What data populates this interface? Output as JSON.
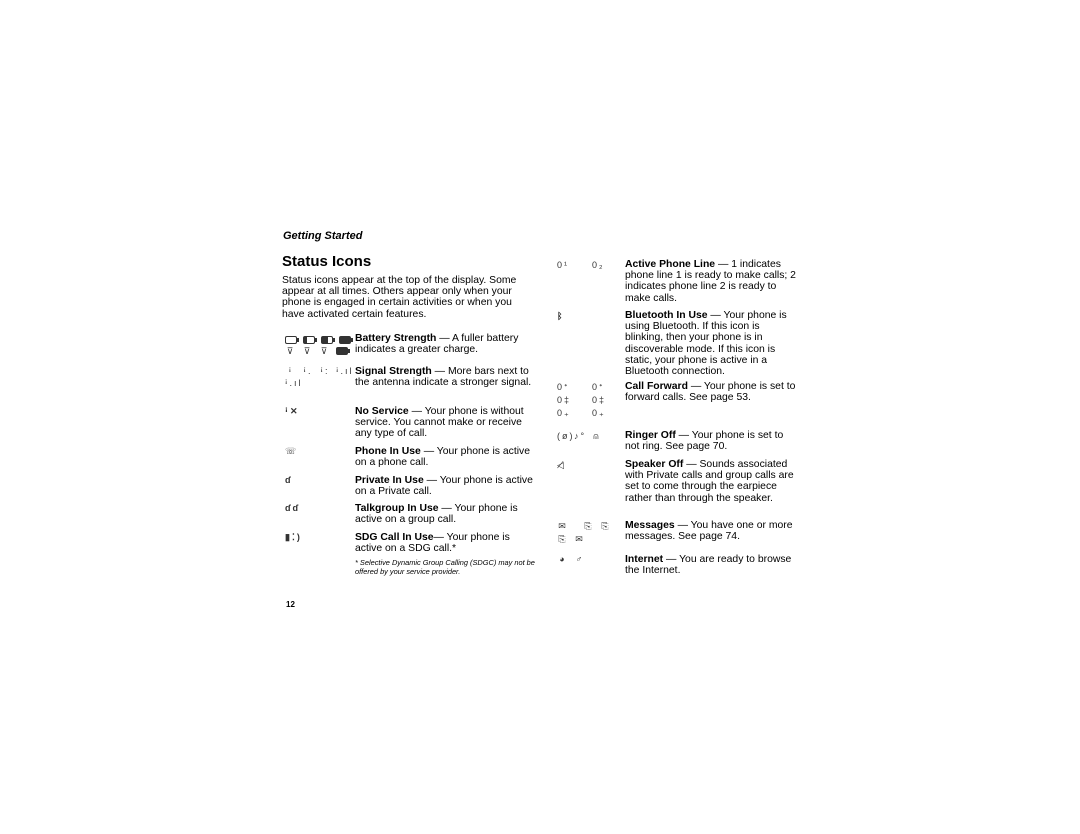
{
  "section_header": "Getting Started",
  "page_title": "Status Icons",
  "intro": "Status icons appear at the top of the display. Some appear at all times. Others appear only when your phone is engaged in certain activities or when you have activated certain features.",
  "left_entries": [
    {
      "name": "battery-strength",
      "icon": "battery-icon",
      "title": "Battery Strength",
      "text": " — A fuller battery indicates a greater charge."
    },
    {
      "name": "signal-strength",
      "icon": "signal-icon",
      "title": "Signal Strength",
      "text": " — More bars next to the antenna indicate a stronger signal."
    },
    {
      "name": "no-service",
      "icon": "no-service-icon",
      "title": "No Service",
      "text": " — Your phone is without service. You cannot make or receive any type of call."
    },
    {
      "name": "phone-in-use",
      "icon": "phone-in-use-icon",
      "title": "Phone In Use",
      "text": " — Your phone is active on a phone call."
    },
    {
      "name": "private-in-use",
      "icon": "private-in-use-icon",
      "title": "Private In Use",
      "text": " — Your phone is active on a Private call."
    },
    {
      "name": "talkgroup-in-use",
      "icon": "talkgroup-icon",
      "title": "Talkgroup In Use",
      "text": " — Your phone is active on a group call."
    },
    {
      "name": "sdg-call-in-use",
      "icon": "sdg-call-icon",
      "title": "SDG Call In Use",
      "text": "— Your phone is active on a SDG call.*"
    }
  ],
  "footnote": "* Selective Dynamic Group Calling (SDGC) may not be offered by your service provider.",
  "right_entries": [
    {
      "name": "active-phone-line",
      "icon": "phone-line-icon",
      "title": "Active Phone Line",
      "text": " — 1 indicates phone line 1 is ready to make calls; 2 indicates phone line 2 is ready to make calls."
    },
    {
      "name": "bluetooth-in-use",
      "icon": "bluetooth-icon",
      "title": "Bluetooth In Use",
      "text": " — Your phone is using Bluetooth. If this icon is blinking, then your phone is in discoverable mode. If this icon is static, your phone is active in a Bluetooth connection."
    },
    {
      "name": "call-forward",
      "icon": "call-forward-icon",
      "title": "Call Forward",
      "text": " — Your phone is set to forward calls. See page 53."
    },
    {
      "name": "ringer-off",
      "icon": "ringer-off-icon",
      "title": "Ringer Off",
      "text": " — Your phone is set to not ring. See page 70."
    },
    {
      "name": "speaker-off",
      "icon": "speaker-off-icon",
      "title": "Speaker Off",
      "text": " — Sounds associated with Private calls and group calls are set to come through the earpiece rather than through the speaker."
    },
    {
      "name": "messages",
      "icon": "messages-icon",
      "title": "Messages",
      "text": " — You have one or more messages. See page 74."
    },
    {
      "name": "internet",
      "icon": "internet-icon",
      "title": "Internet",
      "text": " — You are ready to browse the Internet."
    }
  ],
  "page_number": "12"
}
